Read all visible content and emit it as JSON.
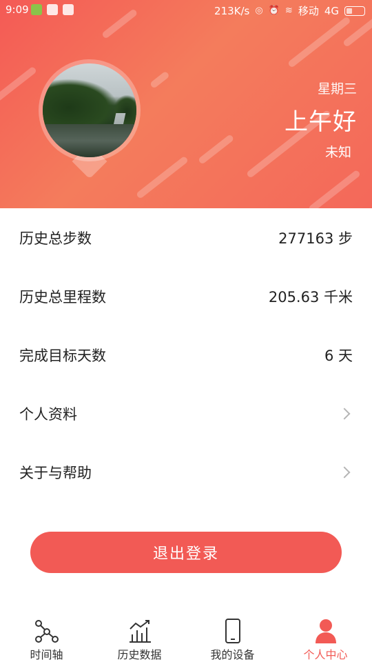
{
  "status_bar": {
    "time": "9:09",
    "network_speed": "213K/s",
    "carrier": "移动",
    "network_type": "4G"
  },
  "header": {
    "weekday": "星期三",
    "greeting": "上午好",
    "weather": "未知"
  },
  "stats": [
    {
      "label": "历史总步数",
      "value": "277163 步"
    },
    {
      "label": "历史总里程数",
      "value": "205.63 千米"
    },
    {
      "label": "完成目标天数",
      "value": "6 天"
    }
  ],
  "menu": [
    {
      "label": "个人资料"
    },
    {
      "label": "关于与帮助"
    }
  ],
  "logout_label": "退出登录",
  "bottom_nav": [
    {
      "label": "时间轴",
      "icon": "timeline-icon",
      "active": false
    },
    {
      "label": "历史数据",
      "icon": "chart-icon",
      "active": false
    },
    {
      "label": "我的设备",
      "icon": "phone-icon",
      "active": false
    },
    {
      "label": "个人中心",
      "icon": "person-icon",
      "active": true
    }
  ],
  "colors": {
    "accent": "#f25a55",
    "header_gradient_start": "#f45a55",
    "header_gradient_end": "#f4685a"
  }
}
